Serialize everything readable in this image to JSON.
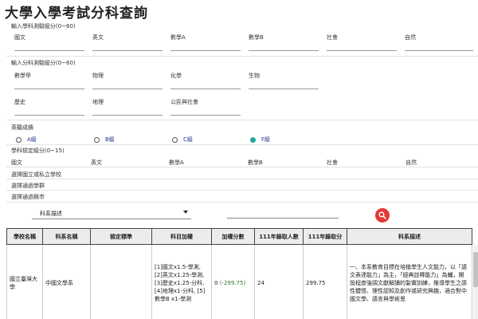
{
  "page": {
    "title": "大學入學考試分科查詢"
  },
  "sections": {
    "ability": {
      "label": "輸入學科測驗級分(0~60)",
      "fields": [
        "國文",
        "英文",
        "數學A",
        "數學B",
        "社會",
        "自然"
      ]
    },
    "subject": {
      "label": "輸入分科測驗級分(0~60)",
      "row1": [
        "數學甲",
        "物理",
        "化學",
        "生物"
      ],
      "row2": [
        "歷史",
        "地理",
        "公民與社會"
      ]
    },
    "listening": {
      "label": "英聽成績",
      "options": [
        "A級",
        "B級",
        "C級",
        "F級"
      ],
      "selected": "F級"
    },
    "standard": {
      "label": "學科檢定級分(0~15)",
      "fields": [
        "國文",
        "英文",
        "數學A",
        "數學B",
        "社會",
        "自然"
      ]
    },
    "filters": {
      "school_type": "選擇國立或私立學校",
      "group": "選擇通過學群",
      "city": "選擇通過縣市"
    }
  },
  "search": {
    "dropdown_value": "科系描述",
    "query": ""
  },
  "table": {
    "headers": [
      "學校名稱",
      "科系名稱",
      "檢定標準",
      "科目加權",
      "加權分數",
      "111年錄取人數",
      "111年錄取分",
      "科系描述"
    ],
    "rows": [
      {
        "school": "國立臺灣大學",
        "dept": "中國文學系",
        "standard": "",
        "weights": "[1]國文x1.5-學測, [2]英文x1.25-學測, [3]歷史x1.25-分科, [4]地理x1-分科, [5]數學B x1-學測",
        "score": "0",
        "score_diff": "(-299.75)",
        "admitted": "24",
        "cutoff": "299.75",
        "desc": "一、本系教育目標在培植學生人文能力，以「語文表達能力」為主，「經典詮釋能力」為輔，開設程度強調文獻解讀的紮實訓練，推導學生之感性體悟、理性認知及創作或研究興趣，適合對中國文學、語言與學術思"
      }
    ]
  }
}
